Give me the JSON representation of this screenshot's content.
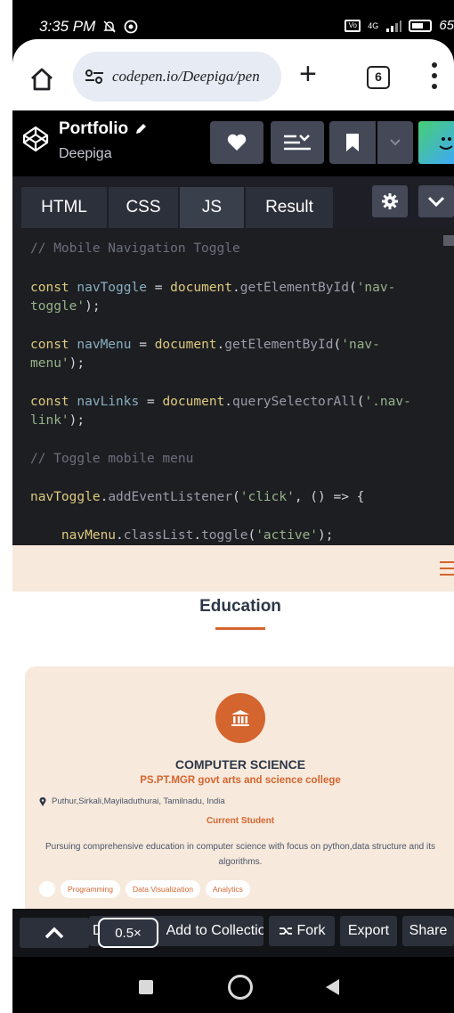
{
  "status_bar": {
    "time": "3:35 PM",
    "network": "4G",
    "battery": "65"
  },
  "browser": {
    "url": "codepen.io/Deepiga/pen",
    "tab_count": "6"
  },
  "codepen": {
    "pen_title": "Portfolio",
    "author": "Deepiga",
    "tabs": [
      "HTML",
      "CSS",
      "JS",
      "Result"
    ],
    "active_tab": "JS"
  },
  "code": {
    "lines": [
      "// Mobile Navigation Toggle",
      "const navToggle = document.getElementById('nav-",
      "toggle');",
      "const navMenu = document.getElementById('nav-",
      "menu');",
      "const navLinks = document.querySelectorAll('.nav-",
      "link');",
      "// Toggle mobile menu",
      "navToggle.addEventListener('click', () => {",
      "    navMenu.classList.toggle('active');"
    ]
  },
  "preview": {
    "section_title": "Education",
    "degree": "COMPUTER SCIENCE",
    "college": "PS.PT.MGR govt arts and science college",
    "location": "Puthur,Sirkali,Mayiladuthurai, Tamilnadu, India",
    "status": "Current Student",
    "description": "Pursuing comprehensive education in computer science with focus on python,data structure and its algorithms.",
    "tags": [
      "Programming",
      "Data Visualization",
      "Analytics"
    ]
  },
  "footer": {
    "zoom": "0.5×",
    "collection_label": "Add to Collection",
    "collection_prefix": "D",
    "fork_label": "Fork",
    "export_label": "Export",
    "share_label": "Share"
  },
  "colors": {
    "accent": "#d4652f",
    "editor_bg": "#1d1e22"
  }
}
